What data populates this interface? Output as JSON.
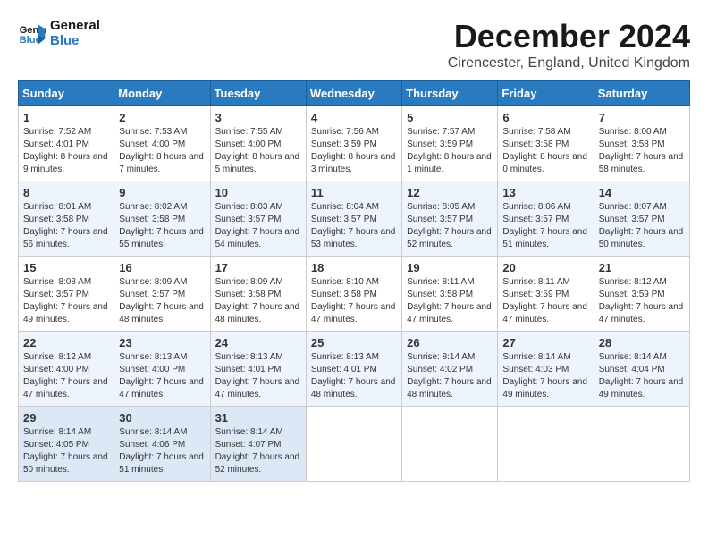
{
  "logo": {
    "text_general": "General",
    "text_blue": "Blue"
  },
  "header": {
    "month": "December 2024",
    "location": "Cirencester, England, United Kingdom"
  },
  "weekdays": [
    "Sunday",
    "Monday",
    "Tuesday",
    "Wednesday",
    "Thursday",
    "Friday",
    "Saturday"
  ],
  "rows": [
    {
      "row_bg": "white",
      "cells": [
        {
          "day": "1",
          "sunrise": "Sunrise: 7:52 AM",
          "sunset": "Sunset: 4:01 PM",
          "daylight": "Daylight: 8 hours and 9 minutes."
        },
        {
          "day": "2",
          "sunrise": "Sunrise: 7:53 AM",
          "sunset": "Sunset: 4:00 PM",
          "daylight": "Daylight: 8 hours and 7 minutes."
        },
        {
          "day": "3",
          "sunrise": "Sunrise: 7:55 AM",
          "sunset": "Sunset: 4:00 PM",
          "daylight": "Daylight: 8 hours and 5 minutes."
        },
        {
          "day": "4",
          "sunrise": "Sunrise: 7:56 AM",
          "sunset": "Sunset: 3:59 PM",
          "daylight": "Daylight: 8 hours and 3 minutes."
        },
        {
          "day": "5",
          "sunrise": "Sunrise: 7:57 AM",
          "sunset": "Sunset: 3:59 PM",
          "daylight": "Daylight: 8 hours and 1 minute."
        },
        {
          "day": "6",
          "sunrise": "Sunrise: 7:58 AM",
          "sunset": "Sunset: 3:58 PM",
          "daylight": "Daylight: 8 hours and 0 minutes."
        },
        {
          "day": "7",
          "sunrise": "Sunrise: 8:00 AM",
          "sunset": "Sunset: 3:58 PM",
          "daylight": "Daylight: 7 hours and 58 minutes."
        }
      ]
    },
    {
      "row_bg": "alt",
      "cells": [
        {
          "day": "8",
          "sunrise": "Sunrise: 8:01 AM",
          "sunset": "Sunset: 3:58 PM",
          "daylight": "Daylight: 7 hours and 56 minutes."
        },
        {
          "day": "9",
          "sunrise": "Sunrise: 8:02 AM",
          "sunset": "Sunset: 3:58 PM",
          "daylight": "Daylight: 7 hours and 55 minutes."
        },
        {
          "day": "10",
          "sunrise": "Sunrise: 8:03 AM",
          "sunset": "Sunset: 3:57 PM",
          "daylight": "Daylight: 7 hours and 54 minutes."
        },
        {
          "day": "11",
          "sunrise": "Sunrise: 8:04 AM",
          "sunset": "Sunset: 3:57 PM",
          "daylight": "Daylight: 7 hours and 53 minutes."
        },
        {
          "day": "12",
          "sunrise": "Sunrise: 8:05 AM",
          "sunset": "Sunset: 3:57 PM",
          "daylight": "Daylight: 7 hours and 52 minutes."
        },
        {
          "day": "13",
          "sunrise": "Sunrise: 8:06 AM",
          "sunset": "Sunset: 3:57 PM",
          "daylight": "Daylight: 7 hours and 51 minutes."
        },
        {
          "day": "14",
          "sunrise": "Sunrise: 8:07 AM",
          "sunset": "Sunset: 3:57 PM",
          "daylight": "Daylight: 7 hours and 50 minutes."
        }
      ]
    },
    {
      "row_bg": "white",
      "cells": [
        {
          "day": "15",
          "sunrise": "Sunrise: 8:08 AM",
          "sunset": "Sunset: 3:57 PM",
          "daylight": "Daylight: 7 hours and 49 minutes."
        },
        {
          "day": "16",
          "sunrise": "Sunrise: 8:09 AM",
          "sunset": "Sunset: 3:57 PM",
          "daylight": "Daylight: 7 hours and 48 minutes."
        },
        {
          "day": "17",
          "sunrise": "Sunrise: 8:09 AM",
          "sunset": "Sunset: 3:58 PM",
          "daylight": "Daylight: 7 hours and 48 minutes."
        },
        {
          "day": "18",
          "sunrise": "Sunrise: 8:10 AM",
          "sunset": "Sunset: 3:58 PM",
          "daylight": "Daylight: 7 hours and 47 minutes."
        },
        {
          "day": "19",
          "sunrise": "Sunrise: 8:11 AM",
          "sunset": "Sunset: 3:58 PM",
          "daylight": "Daylight: 7 hours and 47 minutes."
        },
        {
          "day": "20",
          "sunrise": "Sunrise: 8:11 AM",
          "sunset": "Sunset: 3:59 PM",
          "daylight": "Daylight: 7 hours and 47 minutes."
        },
        {
          "day": "21",
          "sunrise": "Sunrise: 8:12 AM",
          "sunset": "Sunset: 3:59 PM",
          "daylight": "Daylight: 7 hours and 47 minutes."
        }
      ]
    },
    {
      "row_bg": "alt",
      "cells": [
        {
          "day": "22",
          "sunrise": "Sunrise: 8:12 AM",
          "sunset": "Sunset: 4:00 PM",
          "daylight": "Daylight: 7 hours and 47 minutes."
        },
        {
          "day": "23",
          "sunrise": "Sunrise: 8:13 AM",
          "sunset": "Sunset: 4:00 PM",
          "daylight": "Daylight: 7 hours and 47 minutes."
        },
        {
          "day": "24",
          "sunrise": "Sunrise: 8:13 AM",
          "sunset": "Sunset: 4:01 PM",
          "daylight": "Daylight: 7 hours and 47 minutes."
        },
        {
          "day": "25",
          "sunrise": "Sunrise: 8:13 AM",
          "sunset": "Sunset: 4:01 PM",
          "daylight": "Daylight: 7 hours and 48 minutes."
        },
        {
          "day": "26",
          "sunrise": "Sunrise: 8:14 AM",
          "sunset": "Sunset: 4:02 PM",
          "daylight": "Daylight: 7 hours and 48 minutes."
        },
        {
          "day": "27",
          "sunrise": "Sunrise: 8:14 AM",
          "sunset": "Sunset: 4:03 PM",
          "daylight": "Daylight: 7 hours and 49 minutes."
        },
        {
          "day": "28",
          "sunrise": "Sunrise: 8:14 AM",
          "sunset": "Sunset: 4:04 PM",
          "daylight": "Daylight: 7 hours and 49 minutes."
        }
      ]
    },
    {
      "row_bg": "last",
      "cells": [
        {
          "day": "29",
          "sunrise": "Sunrise: 8:14 AM",
          "sunset": "Sunset: 4:05 PM",
          "daylight": "Daylight: 7 hours and 50 minutes."
        },
        {
          "day": "30",
          "sunrise": "Sunrise: 8:14 AM",
          "sunset": "Sunset: 4:06 PM",
          "daylight": "Daylight: 7 hours and 51 minutes."
        },
        {
          "day": "31",
          "sunrise": "Sunrise: 8:14 AM",
          "sunset": "Sunset: 4:07 PM",
          "daylight": "Daylight: 7 hours and 52 minutes."
        },
        {
          "day": "",
          "sunrise": "",
          "sunset": "",
          "daylight": ""
        },
        {
          "day": "",
          "sunrise": "",
          "sunset": "",
          "daylight": ""
        },
        {
          "day": "",
          "sunrise": "",
          "sunset": "",
          "daylight": ""
        },
        {
          "day": "",
          "sunrise": "",
          "sunset": "",
          "daylight": ""
        }
      ]
    }
  ]
}
